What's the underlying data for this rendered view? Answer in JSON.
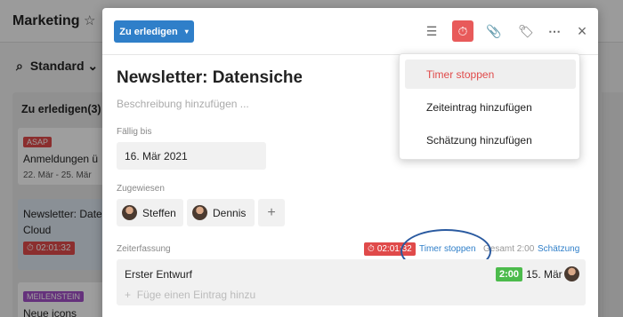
{
  "board": {
    "title": "Marketing",
    "star_icon": "star-icon",
    "filter_label": "Standard",
    "column": {
      "header": "Zu erledigen(3)",
      "cards": [
        {
          "tag": "ASAP",
          "title": "Anmeldungen ü",
          "date": "22. Mär - 25. Mär"
        },
        {
          "title": "Newsletter: Date",
          "title2": "Cloud",
          "timer": "02:01:32"
        },
        {
          "tag": "MEILENSTEIN",
          "title": "Neue icons"
        }
      ]
    }
  },
  "modal": {
    "status_label": "Zu erledigen",
    "title": "Newsletter: Datensicherheit",
    "description_placeholder": "Beschreibung hinzufügen ...",
    "due_label": "Fällig bis",
    "due_value": "16. Mär 2021",
    "assigned_label": "Zugewiesen",
    "assignees": [
      "Steffen",
      "Dennis"
    ],
    "add_assignee": "+",
    "time_tracking_label": "Zeiterfassung",
    "timer_value": "02:01:32",
    "timer_stop_link": "Timer stoppen",
    "total_label": "Gesamt 2:00",
    "estimate_link": "Schätzung",
    "entry": {
      "name": "Erster Entwurf",
      "time": "2:00",
      "date": "15. Mär",
      "add_placeholder": "Füge einen Eintrag hinzu"
    }
  },
  "dropdown": {
    "items": [
      "Timer stoppen",
      "Zeiteintrag hinzufügen",
      "Schätzung hinzufügen"
    ]
  },
  "colors": {
    "accent": "#2f7fc9",
    "danger": "#e04a4a",
    "success": "#4cbb4c"
  }
}
